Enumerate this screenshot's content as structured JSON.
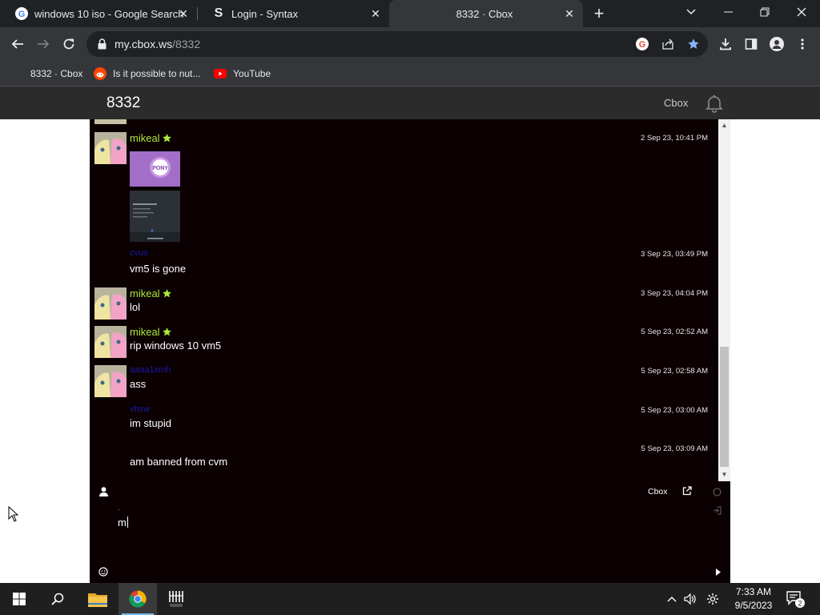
{
  "browser": {
    "tabs": [
      {
        "title": "windows 10 iso - Google Search",
        "favicon": "google-icon"
      },
      {
        "title": "Login - Syntax",
        "favicon": "syntax-s-icon"
      },
      {
        "title": "8332 · Cbox",
        "favicon": "none",
        "active": true
      }
    ],
    "url_host": "my.cbox.ws",
    "url_path": "/8332",
    "bookmarks": [
      {
        "label": "8332 · Cbox",
        "icon": "none"
      },
      {
        "label": "Is it possible to nut...",
        "icon": "reddit-icon"
      },
      {
        "label": "YouTube",
        "icon": "youtube-icon"
      }
    ]
  },
  "cbox": {
    "title": "8332",
    "brand": "Cbox",
    "messages": [
      {
        "user": "mikeal",
        "user_color": "green",
        "star": true,
        "time": "2 Sep 23, 10:41 PM",
        "text": "",
        "images": [
          "my-little-pony-logo",
          "screenshot-thumbnail"
        ]
      },
      {
        "user": "cvus",
        "user_color": "blue",
        "star": false,
        "time": "3 Sep 23, 03:49 PM",
        "text": "vm5 is gone"
      },
      {
        "user": "mikeal",
        "user_color": "green",
        "star": true,
        "time": "3 Sep 23, 04:04 PM",
        "text": "lol"
      },
      {
        "user": "mikeal",
        "user_color": "green",
        "star": true,
        "time": "5 Sep 23, 02:52 AM",
        "text": "rip windows 10 vm5"
      },
      {
        "user": "aaaa1xmh",
        "user_color": "blue",
        "star": false,
        "time": "5 Sep 23, 02:58 AM",
        "text": "ass"
      },
      {
        "user": "vhxw",
        "user_color": "blue",
        "star": false,
        "time": "5 Sep 23, 03:00 AM",
        "text": "im stupid"
      },
      {
        "user": "",
        "user_color": "blue",
        "star": false,
        "time": "5 Sep 23, 03:09 AM",
        "text": "am banned from cvm"
      }
    ],
    "footer_label": "Cbox",
    "input_dot": ".",
    "input_value": "m"
  },
  "taskbar": {
    "time": "7:33 AM",
    "date": "9/5/2023",
    "notification_count": "2"
  },
  "colors": {
    "chat_bg": "#0b0002",
    "username_green": "#aee83a",
    "username_blue": "#1a1aa6",
    "header_bg": "#2b2b2b",
    "chrome_dark": "#202124",
    "chrome_toolbar": "#35363a",
    "bookmark_star": "#8ab4f8"
  }
}
